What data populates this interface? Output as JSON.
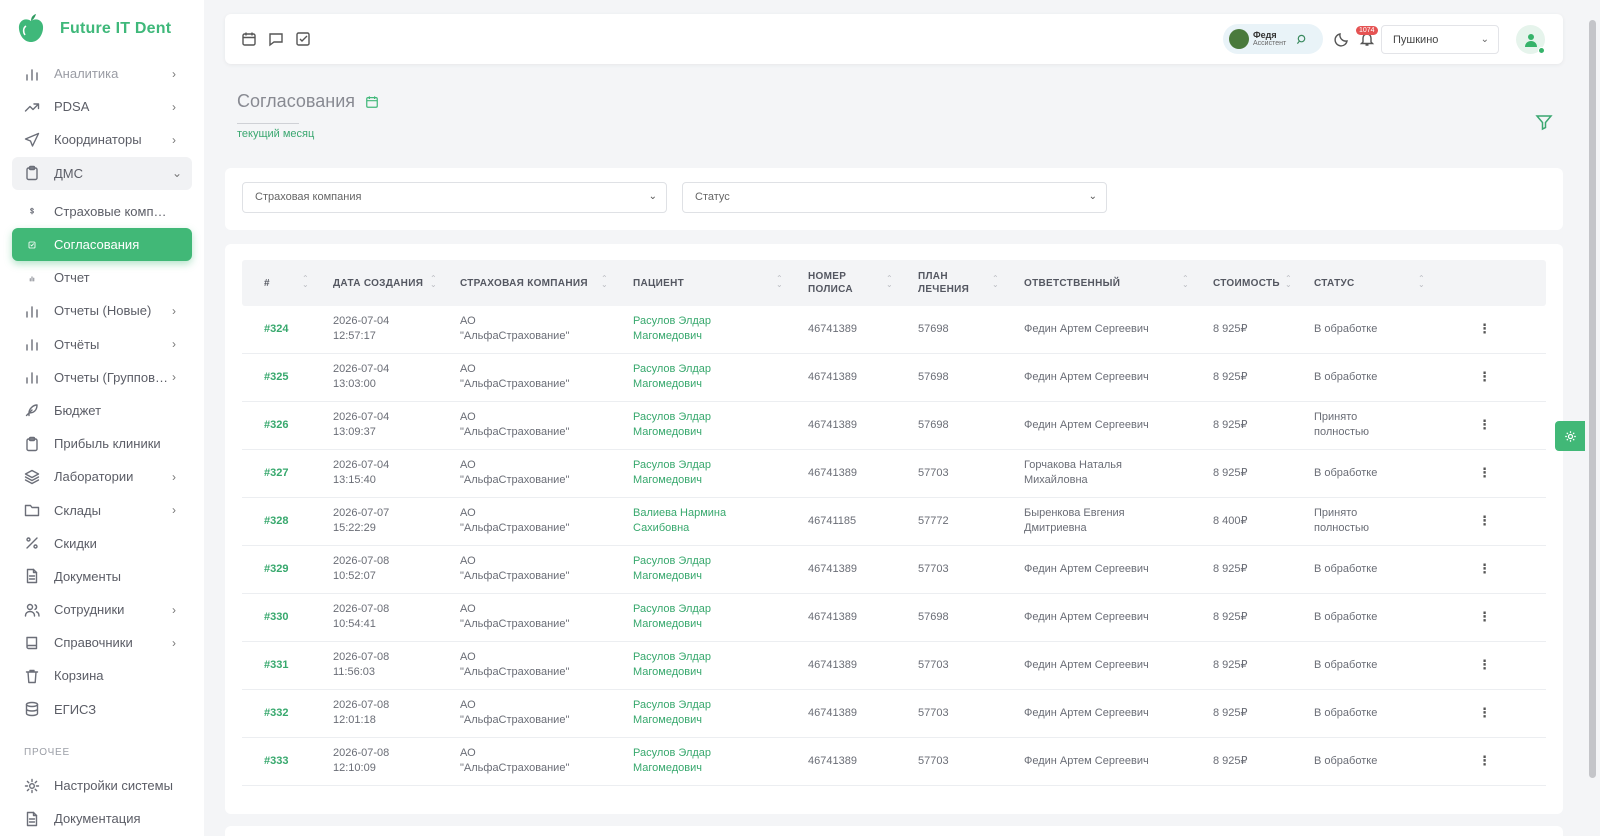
{
  "app": {
    "name": "Future IT Dent",
    "accent": "#41b877"
  },
  "sidebar": {
    "items": [
      {
        "label": "Аналитика",
        "icon": "bar-chart-icon",
        "chevron": "›",
        "state": "faded"
      },
      {
        "label": "PDSA",
        "icon": "trending-up-icon",
        "chevron": "›"
      },
      {
        "label": "Координаторы",
        "icon": "send-icon",
        "chevron": "›"
      },
      {
        "label": "ДМС",
        "icon": "clipboard-icon",
        "chevron": "⌄",
        "state": "open"
      },
      {
        "label": "Страховые компан...",
        "icon": "dollar-icon",
        "chevron": "",
        "state": "sub"
      },
      {
        "label": "Согласования",
        "icon": "check-square-icon",
        "chevron": "",
        "state": "active"
      },
      {
        "label": "Отчет",
        "icon": "chart-small-icon",
        "chevron": "",
        "state": "sub"
      },
      {
        "label": "Отчеты (Новые)",
        "icon": "bar-chart-icon",
        "chevron": "›"
      },
      {
        "label": "Отчёты",
        "icon": "bar-chart-icon",
        "chevron": "›"
      },
      {
        "label": "Отчеты (Групповые)",
        "icon": "bar-chart-icon",
        "chevron": "›"
      },
      {
        "label": "Бюджет",
        "icon": "feather-icon",
        "chevron": ""
      },
      {
        "label": "Прибыль клиники",
        "icon": "clipboard-icon",
        "chevron": ""
      },
      {
        "label": "Лаборатории",
        "icon": "layers-icon",
        "chevron": "›"
      },
      {
        "label": "Склады",
        "icon": "folder-icon",
        "chevron": "›"
      },
      {
        "label": "Скидки",
        "icon": "percent-icon",
        "chevron": ""
      },
      {
        "label": "Документы",
        "icon": "file-icon",
        "chevron": ""
      },
      {
        "label": "Сотрудники",
        "icon": "users-icon",
        "chevron": "›"
      },
      {
        "label": "Справочники",
        "icon": "book-icon",
        "chevron": "›"
      },
      {
        "label": "Корзина",
        "icon": "trash-icon",
        "chevron": ""
      },
      {
        "label": "ЕГИСЗ",
        "icon": "database-icon",
        "chevron": ""
      }
    ],
    "section_other": "ПРОЧЕЕ",
    "other_items": [
      {
        "label": "Настройки системы",
        "icon": "settings-icon"
      },
      {
        "label": "Документация",
        "icon": "file-text-icon"
      }
    ]
  },
  "topbar": {
    "assistant_name": "Федя",
    "assistant_role": "Ассистент",
    "notifications": "1074",
    "branch": "Пушкино"
  },
  "page": {
    "title": "Согласования",
    "period": "текущий месяц"
  },
  "filters": {
    "insurer_placeholder": "Страховая компания",
    "status_placeholder": "Статус"
  },
  "table": {
    "columns": [
      "#",
      "ДАТА СОЗДАНИЯ",
      "СТРАХОВАЯ КОМПАНИЯ",
      "ПАЦИЕНТ",
      "НОМЕР ПОЛИСА",
      "ПЛАН ЛЕЧЕНИЯ",
      "ОТВЕТСТВЕННЫЙ",
      "СТОИМОСТЬ",
      "СТАТУС"
    ],
    "rows": [
      {
        "id": "#324",
        "date": "2026-07-04",
        "time": "12:57:17",
        "insurer1": "АО",
        "insurer2": "\"АльфаСтрахование\"",
        "patient1": "Расулов Элдар",
        "patient2": "Магомедович",
        "policy": "46741389",
        "plan": "57698",
        "resp1": "Федин Артем Сергеевич",
        "resp2": "",
        "cost": "8 925₽",
        "status1": "В обработке",
        "status2": ""
      },
      {
        "id": "#325",
        "date": "2026-07-04",
        "time": "13:03:00",
        "insurer1": "АО",
        "insurer2": "\"АльфаСтрахование\"",
        "patient1": "Расулов Элдар",
        "patient2": "Магомедович",
        "policy": "46741389",
        "plan": "57698",
        "resp1": "Федин Артем Сергеевич",
        "resp2": "",
        "cost": "8 925₽",
        "status1": "В обработке",
        "status2": ""
      },
      {
        "id": "#326",
        "date": "2026-07-04",
        "time": "13:09:37",
        "insurer1": "АО",
        "insurer2": "\"АльфаСтрахование\"",
        "patient1": "Расулов Элдар",
        "patient2": "Магомедович",
        "policy": "46741389",
        "plan": "57698",
        "resp1": "Федин Артем Сергеевич",
        "resp2": "",
        "cost": "8 925₽",
        "status1": "Принято",
        "status2": "полностью"
      },
      {
        "id": "#327",
        "date": "2026-07-04",
        "time": "13:15:40",
        "insurer1": "АО",
        "insurer2": "\"АльфаСтрахование\"",
        "patient1": "Расулов Элдар",
        "patient2": "Магомедович",
        "policy": "46741389",
        "plan": "57703",
        "resp1": "Горчакова Наталья",
        "resp2": "Михайловна",
        "cost": "8 925₽",
        "status1": "В обработке",
        "status2": ""
      },
      {
        "id": "#328",
        "date": "2026-07-07",
        "time": "15:22:29",
        "insurer1": "АО",
        "insurer2": "\"АльфаСтрахование\"",
        "patient1": "Валиева Нармина",
        "patient2": "Сахибовна",
        "policy": "46741185",
        "plan": "57772",
        "resp1": "Быренкова Евгения",
        "resp2": "Дмитриевна",
        "cost": "8 400₽",
        "status1": "Принято",
        "status2": "полностью"
      },
      {
        "id": "#329",
        "date": "2026-07-08",
        "time": "10:52:07",
        "insurer1": "АО",
        "insurer2": "\"АльфаСтрахование\"",
        "patient1": "Расулов Элдар",
        "patient2": "Магомедович",
        "policy": "46741389",
        "plan": "57703",
        "resp1": "Федин Артем Сергеевич",
        "resp2": "",
        "cost": "8 925₽",
        "status1": "В обработке",
        "status2": ""
      },
      {
        "id": "#330",
        "date": "2026-07-08",
        "time": "10:54:41",
        "insurer1": "АО",
        "insurer2": "\"АльфаСтрахование\"",
        "patient1": "Расулов Элдар",
        "patient2": "Магомедович",
        "policy": "46741389",
        "plan": "57698",
        "resp1": "Федин Артем Сергеевич",
        "resp2": "",
        "cost": "8 925₽",
        "status1": "В обработке",
        "status2": ""
      },
      {
        "id": "#331",
        "date": "2026-07-08",
        "time": "11:56:03",
        "insurer1": "АО",
        "insurer2": "\"АльфаСтрахование\"",
        "patient1": "Расулов Элдар",
        "patient2": "Магомедович",
        "policy": "46741389",
        "plan": "57703",
        "resp1": "Федин Артем Сергеевич",
        "resp2": "",
        "cost": "8 925₽",
        "status1": "В обработке",
        "status2": ""
      },
      {
        "id": "#332",
        "date": "2026-07-08",
        "time": "12:01:18",
        "insurer1": "АО",
        "insurer2": "\"АльфаСтрахование\"",
        "patient1": "Расулов Элдар",
        "patient2": "Магомедович",
        "policy": "46741389",
        "plan": "57703",
        "resp1": "Федин Артем Сергеевич",
        "resp2": "",
        "cost": "8 925₽",
        "status1": "В обработке",
        "status2": ""
      },
      {
        "id": "#333",
        "date": "2026-07-08",
        "time": "12:10:09",
        "insurer1": "АО",
        "insurer2": "\"АльфаСтрахование\"",
        "patient1": "Расулов Элдар",
        "patient2": "Магомедович",
        "policy": "46741389",
        "plan": "57703",
        "resp1": "Федин Артем Сергеевич",
        "resp2": "",
        "cost": "8 925₽",
        "status1": "В обработке",
        "status2": ""
      }
    ]
  }
}
